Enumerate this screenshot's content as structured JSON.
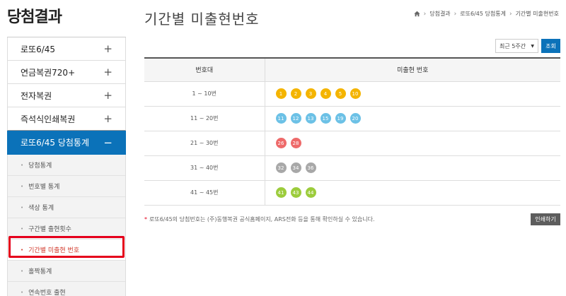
{
  "sidebar": {
    "title": "당첨결과",
    "items": [
      {
        "label": "로또6/45",
        "toggle": "+"
      },
      {
        "label": "연금복권720+",
        "toggle": "+"
      },
      {
        "label": "전자복권",
        "toggle": "+"
      },
      {
        "label": "즉석식인쇄복권",
        "toggle": "+"
      },
      {
        "label": "로또6/45 당첨통계",
        "toggle": "−"
      }
    ],
    "sub_items": [
      {
        "label": "당첨통계"
      },
      {
        "label": "번호별 통계"
      },
      {
        "label": "색상 통계"
      },
      {
        "label": "구간별 출현횟수"
      },
      {
        "label": "기간별 미출현 번호"
      },
      {
        "label": "홀짝통계"
      },
      {
        "label": "연속번호 출현"
      }
    ]
  },
  "main": {
    "title": "기간별 미출현번호",
    "breadcrumb": [
      "당첨결과",
      "로또6/45 당첨통계",
      "기간별 미출현번호"
    ],
    "period_select": "최근 5주간",
    "query_label": "조회",
    "table_headers": [
      "번호대",
      "미출현 번호"
    ],
    "rows": [
      {
        "range": "1 ~ 10번",
        "numbers": [
          "1",
          "2",
          "3",
          "4",
          "5",
          "10"
        ],
        "color": "#f4b400"
      },
      {
        "range": "11 ~ 20번",
        "numbers": [
          "11",
          "12",
          "13",
          "15",
          "19",
          "20"
        ],
        "color": "#6cc1e6"
      },
      {
        "range": "21 ~ 30번",
        "numbers": [
          "26",
          "28"
        ],
        "color": "#ee6a6a"
      },
      {
        "range": "31 ~ 40번",
        "numbers": [
          "32",
          "34",
          "36"
        ],
        "color": "#a8a8a8"
      },
      {
        "range": "41 ~ 45번",
        "numbers": [
          "41",
          "43",
          "44"
        ],
        "color": "#9ccc3c"
      }
    ],
    "footnote": "로또6/45의 당첨번호는 (주)동행복권 공식홈페이지, ARS전화 등을 통해 확인하실 수 있습니다.",
    "print_label": "인쇄하기"
  },
  "colors": {
    "accent": "#0b72b9",
    "active_text": "#d23a2c",
    "highlight_border": "#e5001b"
  }
}
